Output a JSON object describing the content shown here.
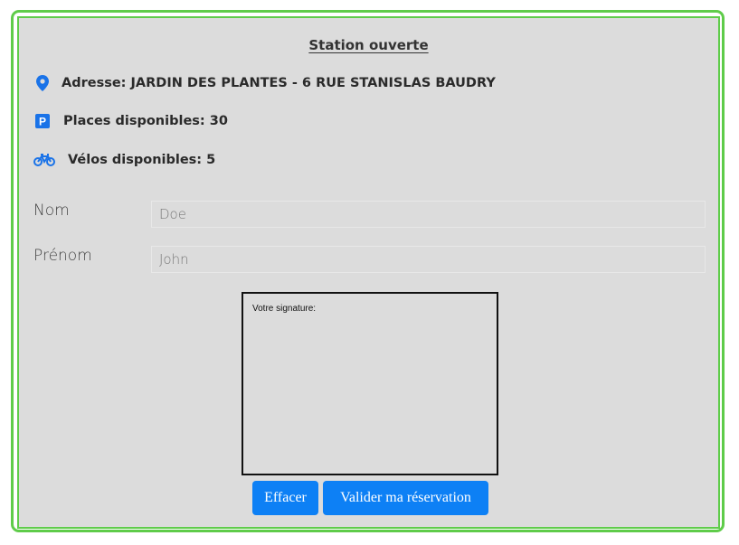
{
  "station": {
    "title": "Station ouverte",
    "address_label": "Adresse: JARDIN DES PLANTES - 6 RUE STANISLAS BAUDRY",
    "places_label": "Places disponibles: 30",
    "bikes_label": "Vélos disponibles: 5"
  },
  "form": {
    "nom_label": "Nom",
    "nom_placeholder": "Doe",
    "prenom_label": "Prénom",
    "prenom_placeholder": "John"
  },
  "signature": {
    "label": "Votre signature:"
  },
  "buttons": {
    "clear": "Effacer",
    "submit": "Valider ma réservation"
  },
  "icons": [
    "map-marker-icon",
    "parking-icon",
    "bicycle-icon"
  ],
  "colors": {
    "border": "#5fcc4a",
    "accent": "#0d80f5",
    "panel": "#dcdcdc"
  }
}
